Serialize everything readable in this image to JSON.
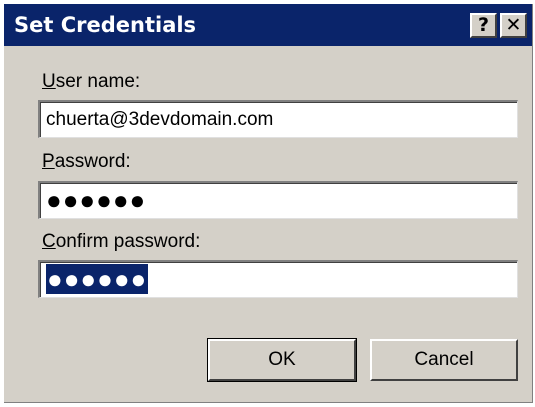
{
  "window": {
    "title": "Set Credentials",
    "help_label": "?",
    "close_label": "✕",
    "title_bg": "#0a246a",
    "face_color": "#d4d0c8"
  },
  "form": {
    "username": {
      "label_accel": "U",
      "label_rest": "ser name:",
      "value": "chuerta@3devdomain.com"
    },
    "password": {
      "label_accel": "P",
      "label_rest": "assword:",
      "value": "●●●●●●"
    },
    "confirm": {
      "label_accel": "C",
      "label_rest": "onfirm password:",
      "value": "●●●●●●"
    }
  },
  "buttons": {
    "ok_label": "OK",
    "cancel_label": "Cancel"
  }
}
